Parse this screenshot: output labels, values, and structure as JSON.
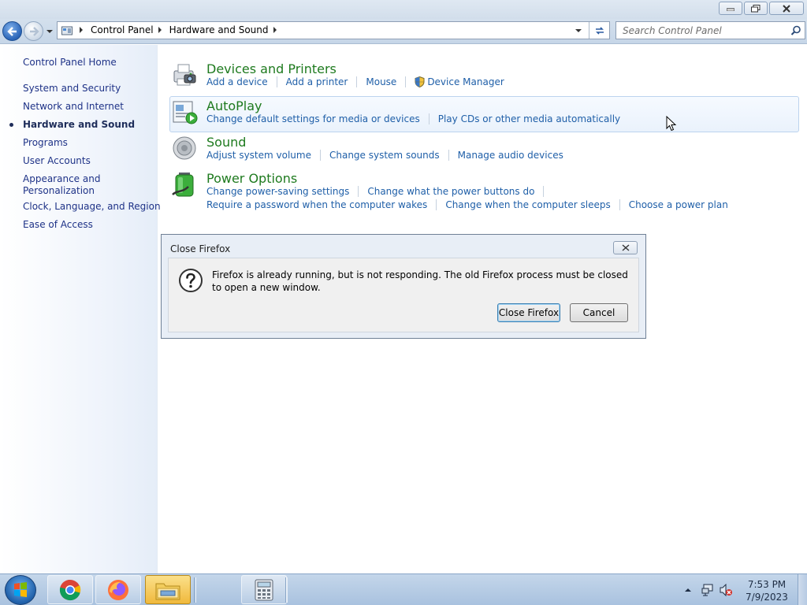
{
  "window": {
    "caption_buttons": {
      "minimize_icon": "minimize-icon",
      "restore_icon": "restore-icon",
      "close_icon": "close-icon"
    }
  },
  "navigation": {
    "breadcrumbs": [
      "Control Panel",
      "Hardware and Sound"
    ],
    "search_placeholder": "Search Control Panel"
  },
  "sidebar": {
    "home_label": "Control Panel Home",
    "items": [
      {
        "label": "System and Security"
      },
      {
        "label": "Network and Internet"
      },
      {
        "label": "Hardware and Sound",
        "active": true
      },
      {
        "label": "Programs"
      },
      {
        "label": "User Accounts"
      },
      {
        "label": "Appearance and Personalization",
        "line1": "Appearance and",
        "line2": "Personalization"
      },
      {
        "label": "Clock, Language, and Region"
      },
      {
        "label": "Ease of Access"
      }
    ]
  },
  "categories": [
    {
      "title": "Devices and Printers",
      "icon": "printer-icon",
      "links": [
        "Add a device",
        "Add a printer",
        "Mouse",
        "Device Manager"
      ]
    },
    {
      "title": "AutoPlay",
      "icon": "autoplay-icon",
      "links": [
        "Change default settings for media or devices",
        "Play CDs or other media automatically"
      ]
    },
    {
      "title": "Sound",
      "icon": "speaker-icon",
      "links": [
        "Adjust system volume",
        "Change system sounds",
        "Manage audio devices"
      ]
    },
    {
      "title": "Power Options",
      "icon": "battery-icon",
      "links": [
        "Change power-saving settings",
        "Change what the power buttons do",
        "Require a password when the computer wakes",
        "Change when the computer sleeps",
        "Choose a power plan"
      ]
    }
  ],
  "dialog": {
    "title": "Close Firefox",
    "message": "Firefox is already running, but is not responding. The old Firefox process must be closed to open a new window.",
    "primary_button": "Close Firefox",
    "cancel_button": "Cancel",
    "icon": "question-icon"
  },
  "taskbar": {
    "items": [
      "start-orb",
      "chrome-icon",
      "firefox-icon",
      "file-explorer-icon",
      "calculator-icon"
    ],
    "clock_time": "7:53 PM",
    "clock_date": "7/9/2023"
  },
  "colors": {
    "link": "#1f5fa8",
    "category_title": "#1e7a1e",
    "sidebar_text": "#1e3287",
    "taskbar": "#a9c2df"
  }
}
